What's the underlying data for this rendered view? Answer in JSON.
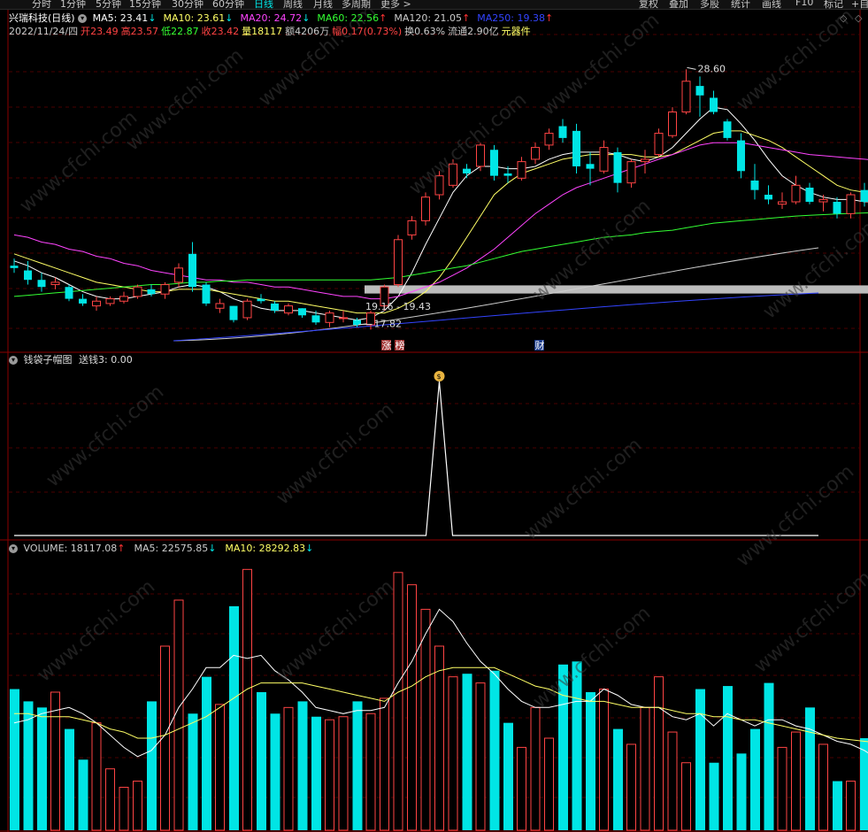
{
  "toolbar": {
    "periods": [
      "分时",
      "1分钟",
      "5分钟",
      "15分钟",
      "30分钟",
      "60分钟",
      "日线",
      "周线",
      "月线",
      "多周期",
      "更多 >"
    ],
    "active_period": "日线",
    "right_buttons": [
      "复权",
      "叠加",
      "多股",
      "统计",
      "画线",
      "F10",
      "标记",
      "+自"
    ]
  },
  "header": {
    "stock": "兴瑞科技(日线)",
    "ma_items": [
      {
        "label": "MA5: 23.41",
        "arrow": "↓",
        "color": "#ffffff",
        "arrow_color": "#00e5e5"
      },
      {
        "label": "MA10: 23.61",
        "arrow": "↓",
        "color": "#ffff66",
        "arrow_color": "#00e5e5"
      },
      {
        "label": "MA20: 24.72",
        "arrow": "↓",
        "color": "#ff44ff",
        "arrow_color": "#00e5e5"
      },
      {
        "label": "MA60: 22.56",
        "arrow": "↑",
        "color": "#33ff33",
        "arrow_color": "#ff3333"
      },
      {
        "label": "MA120: 21.05",
        "arrow": "↑",
        "color": "#cccccc",
        "arrow_color": "#ff3333"
      },
      {
        "label": "MA250: 19.38",
        "arrow": "↑",
        "color": "#3344ff",
        "arrow_color": "#ff3333"
      }
    ],
    "info_items": [
      {
        "text": "2022/11/24/四",
        "color": "#cccccc"
      },
      {
        "text": "开23.49",
        "color": "#ff4444"
      },
      {
        "text": "高23.57",
        "color": "#ff4444"
      },
      {
        "text": "低22.87",
        "color": "#33ff33"
      },
      {
        "text": "收23.42",
        "color": "#ff4444"
      },
      {
        "text": "量18117",
        "color": "#ffff66"
      },
      {
        "text": "额4206万",
        "color": "#cccccc"
      },
      {
        "text": "幅0.17(0.73%)",
        "color": "#ff4444"
      },
      {
        "text": "换0.63%",
        "color": "#cccccc"
      },
      {
        "text": "流通2.90亿",
        "color": "#cccccc"
      },
      {
        "text": "元器件",
        "color": "#ffff66"
      }
    ]
  },
  "annotations": {
    "high_label": "28.60",
    "low_label": "17.82",
    "range_label": "19.16 - 19.43",
    "tag_zhang": "涨",
    "tag_bang": "榜",
    "tag_cai": "财"
  },
  "indicator": {
    "title": "钱袋子帽图",
    "value_text": "送钱3: 0.00",
    "icon": "money-bag-icon"
  },
  "volume_header": {
    "items": [
      {
        "label": "VOLUME: 18117.08",
        "arrow": "↑",
        "color": "#cccccc",
        "arrow_color": "#ff3333"
      },
      {
        "label": "MA5: 22575.85",
        "arrow": "↓",
        "color": "#cccccc",
        "arrow_color": "#00e5e5"
      },
      {
        "label": "MA10: 28292.83",
        "arrow": "↓",
        "color": "#ffff66",
        "arrow_color": "#00e5e5"
      }
    ]
  },
  "watermark": "www.cfchi.com",
  "colors": {
    "up": "#ff4444",
    "down": "#00e5e5",
    "bg": "#000000",
    "grid": "#4a0000",
    "panel_border": "#8b0000"
  },
  "chart_data": [
    {
      "type": "candlestick",
      "title": "兴瑞科技(日线)",
      "ylim": [
        17.2,
        30.0
      ],
      "candles": [
        [
          20.3,
          20.6,
          20.0,
          20.2
        ],
        [
          20.1,
          20.5,
          19.5,
          19.7
        ],
        [
          19.7,
          20.0,
          19.2,
          19.4
        ],
        [
          19.5,
          19.8,
          19.3,
          19.6
        ],
        [
          19.4,
          19.5,
          18.8,
          18.9
        ],
        [
          18.9,
          19.1,
          18.6,
          18.7
        ],
        [
          18.6,
          19.0,
          18.4,
          18.8
        ],
        [
          18.7,
          19.0,
          18.6,
          18.9
        ],
        [
          18.8,
          19.2,
          18.7,
          19.0
        ],
        [
          19.0,
          19.5,
          18.9,
          19.4
        ],
        [
          19.3,
          19.5,
          19.0,
          19.1
        ],
        [
          19.1,
          19.6,
          18.9,
          19.5
        ],
        [
          19.6,
          20.4,
          19.4,
          20.2
        ],
        [
          20.8,
          21.3,
          19.2,
          19.4
        ],
        [
          19.5,
          19.6,
          18.6,
          18.7
        ],
        [
          18.5,
          18.9,
          18.3,
          18.7
        ],
        [
          18.6,
          18.6,
          17.9,
          18.0
        ],
        [
          18.1,
          18.9,
          18.0,
          18.8
        ],
        [
          18.9,
          19.1,
          18.7,
          18.8
        ],
        [
          18.7,
          18.8,
          18.3,
          18.4
        ],
        [
          18.3,
          18.7,
          18.2,
          18.6
        ],
        [
          18.5,
          18.5,
          18.1,
          18.2
        ],
        [
          18.2,
          18.4,
          17.8,
          17.9
        ],
        [
          17.9,
          18.4,
          17.7,
          18.3
        ],
        [
          18.1,
          18.4,
          17.9,
          18.1
        ],
        [
          18.0,
          18.1,
          17.7,
          17.8
        ],
        [
          17.8,
          18.4,
          17.6,
          18.3
        ],
        [
          18.6,
          19.5,
          18.4,
          19.4
        ],
        [
          19.5,
          21.6,
          19.4,
          21.4
        ],
        [
          21.6,
          22.4,
          21.4,
          22.2
        ],
        [
          22.2,
          23.4,
          22.0,
          23.2
        ],
        [
          23.3,
          24.3,
          23.1,
          24.1
        ],
        [
          23.7,
          24.8,
          23.6,
          24.6
        ],
        [
          24.4,
          24.6,
          24.0,
          24.2
        ],
        [
          24.5,
          25.5,
          24.3,
          25.4
        ],
        [
          25.2,
          25.4,
          23.9,
          24.1
        ],
        [
          24.2,
          24.5,
          23.8,
          24.1
        ],
        [
          24.0,
          24.9,
          23.9,
          24.7
        ],
        [
          24.8,
          25.5,
          24.6,
          25.3
        ],
        [
          25.4,
          26.1,
          25.2,
          25.9
        ],
        [
          26.2,
          26.5,
          25.5,
          25.7
        ],
        [
          26.0,
          26.3,
          24.2,
          24.5
        ],
        [
          24.6,
          25.1,
          23.7,
          24.4
        ],
        [
          24.3,
          25.6,
          24.2,
          25.3
        ],
        [
          25.1,
          25.3,
          23.4,
          23.8
        ],
        [
          23.8,
          24.8,
          23.6,
          24.7
        ],
        [
          24.7,
          25.2,
          24.2,
          24.8
        ],
        [
          25.0,
          26.1,
          24.9,
          25.9
        ],
        [
          25.8,
          27.0,
          25.7,
          26.8
        ],
        [
          26.8,
          28.6,
          26.7,
          28.1
        ],
        [
          27.9,
          28.3,
          26.6,
          27.5
        ],
        [
          27.4,
          27.7,
          26.7,
          26.8
        ],
        [
          26.4,
          26.5,
          25.6,
          25.7
        ],
        [
          25.6,
          25.9,
          24.0,
          24.3
        ],
        [
          23.9,
          24.6,
          23.1,
          23.5
        ],
        [
          23.3,
          23.7,
          22.9,
          23.1
        ],
        [
          22.9,
          23.4,
          22.7,
          23.0
        ],
        [
          23.0,
          24.1,
          22.9,
          23.7
        ],
        [
          23.6,
          23.8,
          22.9,
          23.0
        ],
        [
          23.0,
          23.3,
          22.6,
          23.1
        ],
        [
          23.0,
          23.2,
          22.3,
          22.5
        ],
        [
          22.5,
          23.4,
          22.3,
          23.3
        ],
        [
          23.5,
          23.8,
          22.8,
          23.0
        ],
        [
          22.8,
          23.1,
          22.3,
          23.0
        ],
        [
          23.49,
          23.57,
          22.87,
          23.42
        ]
      ],
      "ma_lines": {
        "MA5": [
          20.5,
          20.3,
          20.0,
          19.8,
          19.5,
          19.2,
          19.0,
          18.9,
          18.9,
          19.0,
          19.1,
          19.2,
          19.4,
          19.5,
          19.4,
          19.2,
          18.9,
          18.7,
          18.5,
          18.4,
          18.4,
          18.4,
          18.3,
          18.2,
          18.1,
          18.0,
          18.1,
          18.4,
          19.0,
          20.0,
          21.2,
          22.3,
          23.4,
          24.1,
          24.5,
          24.5,
          24.4,
          24.4,
          24.5,
          24.8,
          25.0,
          25.1,
          25.1,
          25.1,
          25.0,
          24.8,
          24.7,
          24.9,
          25.3,
          25.9,
          26.5,
          27.0,
          26.9,
          26.3,
          25.6,
          24.8,
          24.1,
          23.7,
          23.4,
          23.2,
          23.1,
          23.1,
          23.0,
          23.0,
          23.41
        ],
        "MA10": [
          20.8,
          20.6,
          20.4,
          20.2,
          20.0,
          19.8,
          19.6,
          19.5,
          19.4,
          19.3,
          19.2,
          19.2,
          19.3,
          19.3,
          19.3,
          19.2,
          19.1,
          19.0,
          18.9,
          18.8,
          18.8,
          18.7,
          18.6,
          18.5,
          18.4,
          18.3,
          18.3,
          18.3,
          18.5,
          18.8,
          19.2,
          19.8,
          20.6,
          21.5,
          22.4,
          23.3,
          23.8,
          24.2,
          24.4,
          24.6,
          24.8,
          24.9,
          25.0,
          25.0,
          25.0,
          25.0,
          24.9,
          24.9,
          25.0,
          25.3,
          25.6,
          25.9,
          26.0,
          26.0,
          25.8,
          25.6,
          25.3,
          24.9,
          24.5,
          24.1,
          23.7,
          23.5,
          23.4,
          23.5,
          23.61
        ],
        "MA20": [
          21.6,
          21.5,
          21.3,
          21.2,
          21.0,
          20.9,
          20.7,
          20.6,
          20.4,
          20.3,
          20.1,
          20.0,
          19.9,
          19.8,
          19.7,
          19.7,
          19.6,
          19.6,
          19.5,
          19.4,
          19.4,
          19.3,
          19.2,
          19.1,
          19.0,
          19.0,
          18.9,
          18.9,
          19.0,
          19.2,
          19.4,
          19.6,
          19.9,
          20.2,
          20.6,
          21.0,
          21.5,
          22.0,
          22.5,
          22.9,
          23.3,
          23.6,
          23.8,
          24.0,
          24.2,
          24.4,
          24.6,
          24.8,
          25.0,
          25.2,
          25.4,
          25.5,
          25.5,
          25.5,
          25.4,
          25.3,
          25.2,
          25.1,
          25.0,
          24.95,
          24.9,
          24.85,
          24.8,
          24.75,
          24.72
        ],
        "MA60": [
          19.0,
          19.05,
          19.1,
          19.15,
          19.2,
          19.25,
          19.3,
          19.35,
          19.4,
          19.45,
          19.5,
          19.5,
          19.55,
          19.6,
          19.6,
          19.65,
          19.65,
          19.7,
          19.7,
          19.7,
          19.7,
          19.7,
          19.7,
          19.7,
          19.7,
          19.7,
          19.7,
          19.75,
          19.8,
          19.9,
          20.0,
          20.1,
          20.2,
          20.3,
          20.45,
          20.6,
          20.75,
          20.9,
          21.0,
          21.1,
          21.2,
          21.3,
          21.4,
          21.5,
          21.55,
          21.6,
          21.7,
          21.75,
          21.8,
          21.9,
          22.0,
          22.1,
          22.15,
          22.2,
          22.25,
          22.3,
          22.35,
          22.4,
          22.43,
          22.46,
          22.49,
          22.51,
          22.53,
          22.55,
          22.56
        ]
      },
      "horizontal_band": [
        19.16,
        19.43
      ],
      "marked_high": 28.6,
      "marked_low": 17.82
    },
    {
      "type": "line",
      "title": "钱袋子帽图",
      "series": [
        {
          "name": "送钱3",
          "spike_index": 31,
          "values": [
            0,
            1,
            0
          ]
        }
      ]
    },
    {
      "type": "bar",
      "title": "VOLUME",
      "ylim": [
        0,
        90000
      ],
      "values": [
        46000,
        42000,
        40000,
        45000,
        33000,
        23000,
        35000,
        20000,
        14000,
        16000,
        42000,
        60000,
        75000,
        38000,
        50000,
        41000,
        73000,
        85000,
        45000,
        38000,
        40000,
        42000,
        37000,
        36000,
        37000,
        42000,
        38000,
        43000,
        84000,
        80000,
        72000,
        60000,
        50000,
        51000,
        48000,
        52000,
        35000,
        27000,
        40000,
        30000,
        54000,
        55000,
        45000,
        46000,
        33000,
        28000,
        40000,
        50000,
        32000,
        22000,
        46000,
        22000,
        47000,
        25000,
        33000,
        48000,
        27000,
        32000,
        40000,
        28000,
        16000,
        16000,
        30000,
        19000,
        18117
      ],
      "ma5": [
        35000,
        36000,
        38000,
        39000,
        40000,
        38000,
        35000,
        31000,
        27000,
        24000,
        26000,
        31000,
        40000,
        46000,
        53000,
        53000,
        57000,
        56000,
        57000,
        52000,
        49000,
        45000,
        40000,
        39000,
        38000,
        39000,
        39000,
        40000,
        48000,
        55000,
        64000,
        72000,
        68000,
        61000,
        55000,
        51000,
        46000,
        42000,
        40000,
        40000,
        41000,
        42000,
        42000,
        46000,
        44000,
        41000,
        40000,
        40000,
        37000,
        36000,
        38000,
        34000,
        38000,
        36000,
        34000,
        36000,
        36000,
        34000,
        33000,
        31000,
        29000,
        28000,
        26000,
        23000,
        22576
      ],
      "ma10": [
        38000,
        38000,
        37000,
        37000,
        37000,
        36000,
        35000,
        33000,
        32000,
        30000,
        30000,
        31000,
        33000,
        35000,
        37000,
        40000,
        43000,
        46000,
        48000,
        48000,
        48000,
        48000,
        47000,
        46000,
        45000,
        44000,
        43000,
        42000,
        45000,
        47000,
        50000,
        52000,
        53000,
        53000,
        53000,
        53000,
        51000,
        49000,
        47000,
        46000,
        44000,
        43000,
        42000,
        42000,
        41000,
        40000,
        40000,
        40000,
        39000,
        38000,
        38000,
        37000,
        37000,
        36000,
        36000,
        35000,
        34000,
        33000,
        32000,
        31000,
        30000,
        29500,
        29000,
        28500,
        28293
      ]
    }
  ]
}
